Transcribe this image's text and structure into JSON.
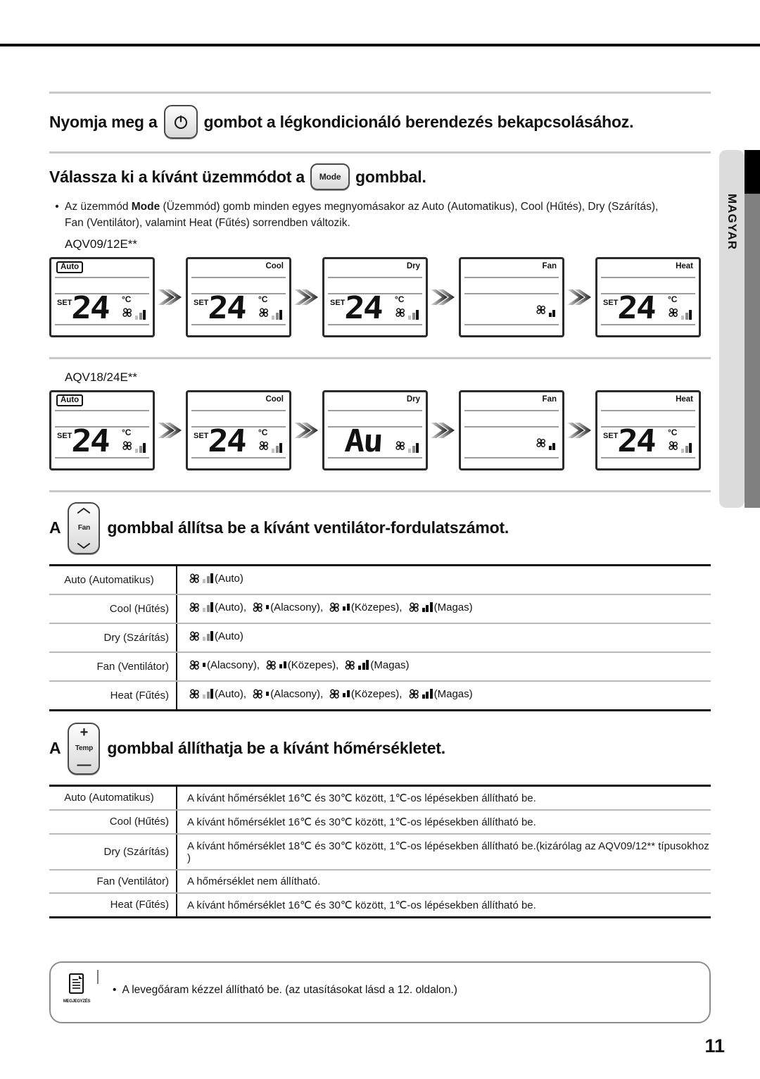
{
  "side_tab": {
    "language": "MAGYAR"
  },
  "page_number": "11",
  "steps": {
    "power": {
      "text_before": "Nyomja meg a",
      "button_icon": "power-icon",
      "text_after": "gombot a légkondicionáló berendezés bekapcsolásához."
    },
    "mode": {
      "text_before": "Válassza ki a kívánt üzemmódot a",
      "button_label": "Mode",
      "text_after": "gombbal.",
      "bullet_line1_a": "Az üzemmód ",
      "bullet_line1_b": "Mode",
      "bullet_line1_c": " (Üzemmód) gomb minden egyes megnyomásakor az Auto (Automatikus), Cool (Hűtés), Dry (Szárítás),",
      "bullet_line2": "Fan (Ventilátor), valamint Heat (Fűtés) sorrendben változik."
    },
    "fan": {
      "text_before": "A",
      "button_label": "Fan",
      "text_after": "gombbal állítsa be a kívánt ventilátor-fordulatszámot."
    },
    "temp": {
      "text_before": "A",
      "button_label": "Temp",
      "button_plus": "+",
      "button_minus": "—",
      "text_after": "gombbal állíthatja be a kívánt hőmérsékletet."
    }
  },
  "lcd_groups": [
    {
      "model": "AQV09/12E**",
      "panels": [
        {
          "title": "Auto",
          "boxed_title": true,
          "set_label": "SET",
          "value": "24",
          "degree": "°C",
          "fan_level": "auto"
        },
        {
          "title": "Cool",
          "boxed_title": false,
          "set_label": "SET",
          "value": "24",
          "degree": "°C",
          "fan_level": "auto"
        },
        {
          "title": "Dry",
          "boxed_title": false,
          "set_label": "SET",
          "value": "24",
          "degree": "°C",
          "fan_level": "auto"
        },
        {
          "title": "Fan",
          "boxed_title": false,
          "set_label": "",
          "value": "",
          "degree": "",
          "fan_level": "medium"
        },
        {
          "title": "Heat",
          "boxed_title": false,
          "set_label": "SET",
          "value": "24",
          "degree": "°C",
          "fan_level": "auto"
        }
      ]
    },
    {
      "model": "AQV18/24E**",
      "panels": [
        {
          "title": "Auto",
          "boxed_title": true,
          "set_label": "SET",
          "value": "24",
          "degree": "°C",
          "fan_level": "auto"
        },
        {
          "title": "Cool",
          "boxed_title": false,
          "set_label": "SET",
          "value": "24",
          "degree": "°C",
          "fan_level": "auto"
        },
        {
          "title": "Dry",
          "boxed_title": false,
          "set_label": "",
          "value": "Au",
          "degree": "",
          "fan_level": "auto"
        },
        {
          "title": "Fan",
          "boxed_title": false,
          "set_label": "",
          "value": "",
          "degree": "",
          "fan_level": "medium"
        },
        {
          "title": "Heat",
          "boxed_title": false,
          "set_label": "SET",
          "value": "24",
          "degree": "°C",
          "fan_level": "auto"
        }
      ]
    }
  ],
  "fan_table": {
    "rows": [
      {
        "mode": "Auto (Automatikus)",
        "items": [
          {
            "level": "auto",
            "text": "(Auto)"
          }
        ]
      },
      {
        "mode": "Cool (Hűtés)",
        "items": [
          {
            "level": "auto",
            "text": "(Auto),"
          },
          {
            "level": "low",
            "text": "(Alacsony),"
          },
          {
            "level": "medium",
            "text": "(Közepes),"
          },
          {
            "level": "high",
            "text": "(Magas)"
          }
        ]
      },
      {
        "mode": "Dry (Szárítás)",
        "items": [
          {
            "level": "auto",
            "text": "(Auto)"
          }
        ]
      },
      {
        "mode": "Fan (Ventilátor)",
        "items": [
          {
            "level": "low",
            "text": "(Alacsony),"
          },
          {
            "level": "medium",
            "text": "(Közepes),"
          },
          {
            "level": "high",
            "text": "(Magas)"
          }
        ]
      },
      {
        "mode": "Heat (Fűtés)",
        "items": [
          {
            "level": "auto",
            "text": "(Auto),"
          },
          {
            "level": "low",
            "text": "(Alacsony),"
          },
          {
            "level": "medium",
            "text": "(Közepes),"
          },
          {
            "level": "high",
            "text": "(Magas)"
          }
        ]
      }
    ]
  },
  "temp_table": {
    "rows": [
      {
        "mode": "Auto (Automatikus)",
        "desc": "A kívánt hőmérséklet 16℃ és 30℃ között, 1℃-os lépésekben állítható be."
      },
      {
        "mode": "Cool (Hűtés)",
        "desc": "A kívánt hőmérséklet 16℃ és 30℃ között, 1℃-os lépésekben állítható be."
      },
      {
        "mode": "Dry (Szárítás)",
        "desc": "A kívánt hőmérséklet 18℃ és 30℃ között, 1℃-os lépésekben állítható be.(kizárólag az AQV09/12** típusokhoz )"
      },
      {
        "mode": "Fan (Ventilátor)",
        "desc": "A hőmérséklet nem állítható."
      },
      {
        "mode": "Heat (Fűtés)",
        "desc": "A kívánt hőmérséklet 16℃ és 30℃ között, 1℃-os lépésekben állítható be."
      }
    ]
  },
  "note": {
    "icon_caption": "MEGJEGYZÉS",
    "bullet": "•",
    "text": "A levegőáram kézzel állítható be. (az utasításokat lásd a 12. oldalon.)"
  }
}
